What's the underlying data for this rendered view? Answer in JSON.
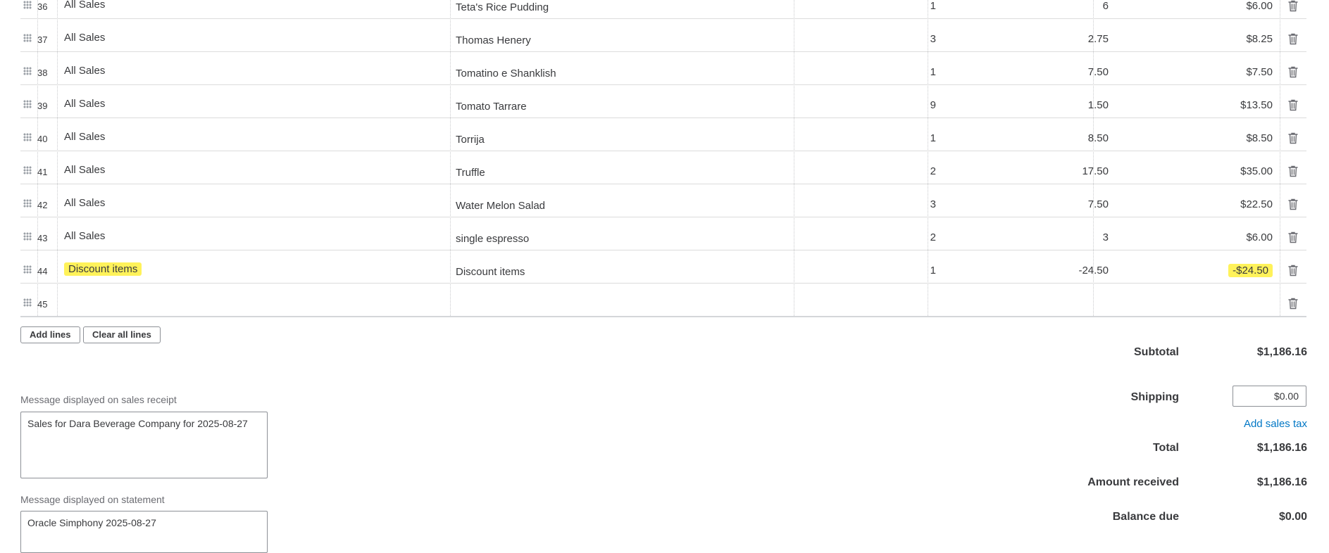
{
  "lines": [
    {
      "num": "36",
      "category": "All Sales",
      "description": "Teta's Rice Pudding",
      "qty": "1",
      "rate": "6",
      "amount": "$6.00"
    },
    {
      "num": "37",
      "category": "All Sales",
      "description": "Thomas Henery",
      "qty": "3",
      "rate": "2.75",
      "amount": "$8.25"
    },
    {
      "num": "38",
      "category": "All Sales",
      "description": "Tomatino e Shanklish",
      "qty": "1",
      "rate": "7.50",
      "amount": "$7.50"
    },
    {
      "num": "39",
      "category": "All Sales",
      "description": "Tomato Tarrare",
      "qty": "9",
      "rate": "1.50",
      "amount": "$13.50"
    },
    {
      "num": "40",
      "category": "All Sales",
      "description": "Torrija",
      "qty": "1",
      "rate": "8.50",
      "amount": "$8.50"
    },
    {
      "num": "41",
      "category": "All Sales",
      "description": "Truffle",
      "qty": "2",
      "rate": "17.50",
      "amount": "$35.00"
    },
    {
      "num": "42",
      "category": "All Sales",
      "description": "Water Melon Salad",
      "qty": "3",
      "rate": "7.50",
      "amount": "$22.50"
    },
    {
      "num": "43",
      "category": "All Sales",
      "description": "single espresso",
      "qty": "2",
      "rate": "3",
      "amount": "$6.00"
    },
    {
      "num": "44",
      "category": "Discount items",
      "description": "Discount items",
      "qty": "1",
      "rate": "-24.50",
      "amount": "-$24.50"
    },
    {
      "num": "45",
      "category": "",
      "description": "",
      "qty": "",
      "rate": "",
      "amount": ""
    }
  ],
  "buttons": {
    "add_lines": "Add lines",
    "clear_all_lines": "Clear all lines"
  },
  "memo": {
    "receipt_label": "Message displayed on sales receipt",
    "receipt_value": "Sales for Dara Beverage Company for 2025-08-27",
    "statement_label": "Message displayed on statement",
    "statement_value": "Oracle Simphony 2025-08-27"
  },
  "totals": {
    "subtotal_label": "Subtotal",
    "subtotal_value": "$1,186.16",
    "shipping_label": "Shipping",
    "shipping_value": "$0.00",
    "add_sales_tax": "Add sales tax",
    "total_label": "Total",
    "total_value": "$1,186.16",
    "amount_received_label": "Amount received",
    "amount_received_value": "$1,186.16",
    "balance_due_label": "Balance due",
    "balance_due_value": "$0.00"
  },
  "colors": {
    "highlight": "#fff25a",
    "link": "#0077c5",
    "text": "#393a3d"
  },
  "icons": {
    "drag": "drag-handle-icon",
    "delete": "trash-icon"
  }
}
